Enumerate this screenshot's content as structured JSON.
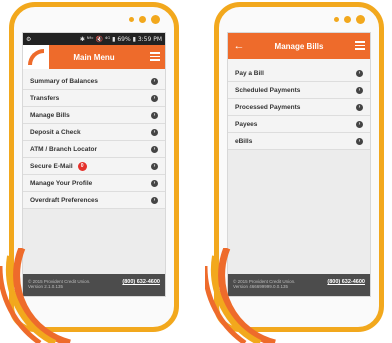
{
  "left": {
    "status": {
      "left": "⚙",
      "right": "✱ ᴺᶠᶜ 🔇 ⁴ᴳ ▮ 69% ▮ 3:59 PM"
    },
    "title": "Main Menu",
    "items": [
      {
        "label": "Summary of Balances"
      },
      {
        "label": "Transfers"
      },
      {
        "label": "Manage Bills"
      },
      {
        "label": "Deposit a Check"
      },
      {
        "label": "ATM / Branch Locator"
      },
      {
        "label": "Secure E-Mail",
        "badge": "0"
      },
      {
        "label": "Manage Your Profile"
      },
      {
        "label": "Overdraft Preferences"
      }
    ],
    "footer": {
      "line1": "© 2015 Provident Credit Union.",
      "line2": "Version 2.1.0.135",
      "phone": "(800) 632-4600"
    }
  },
  "right": {
    "back": "←",
    "title": "Manage Bills",
    "items": [
      {
        "label": "Pay a Bill"
      },
      {
        "label": "Scheduled Payments"
      },
      {
        "label": "Processed Payments"
      },
      {
        "label": "Payees"
      },
      {
        "label": "eBills"
      }
    ],
    "footer": {
      "line1": "© 2015 Provident Credit Union.",
      "line2": "Version 466699999.0.0.135",
      "phone": "(800) 632-4600"
    }
  },
  "colors": {
    "accent": "#f2a81d",
    "header": "#ee6b2b",
    "footer": "#4c4c4c"
  }
}
